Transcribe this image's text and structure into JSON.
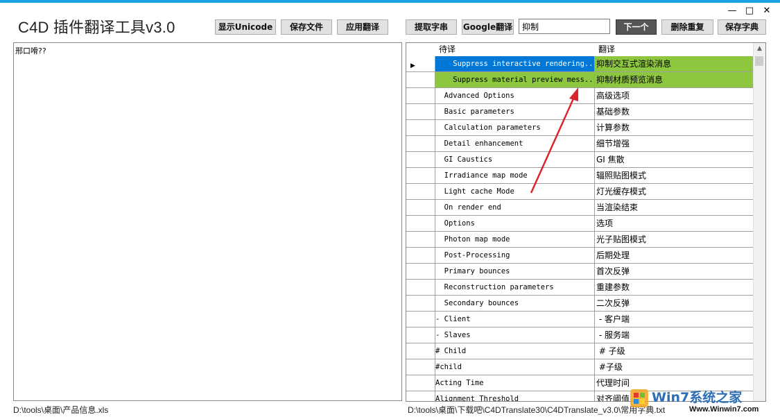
{
  "window": {
    "title": "C4D 插件翻译工具v3.0",
    "minimize": "—",
    "maximize": "□",
    "close": "✕"
  },
  "toolbar": {
    "show_unicode": "显示Unicode",
    "save_file": "保存文件",
    "apply_translation": "应用翻译",
    "extract_strings": "提取字串",
    "google_translate": "Google翻译",
    "search_value": "抑制",
    "next": "下一个",
    "delete_duplicates": "删除重复",
    "save_dictionary": "保存字典"
  },
  "editor": {
    "text": "邢口嗗??"
  },
  "status": {
    "left_path": "D:\\tools\\桌面\\产品信息.xls",
    "right_path": "D:\\tools\\桌面\\下载吧\\C4DTranslate30\\C4DTranslate_v3.0\\常用字典.txt"
  },
  "grid": {
    "headers": [
      "待译",
      "翻译"
    ],
    "current_row_marker": "▶",
    "rows": [
      {
        "source": "    Suppress interactive rendering...",
        "target": "抑制交互式渲染消息"
      },
      {
        "source": "    Suppress material preview mess...",
        "target": "抑制材质预览消息"
      },
      {
        "source": "  Advanced Options",
        "target": "高级选项"
      },
      {
        "source": "  Basic parameters",
        "target": "基础参数"
      },
      {
        "source": "  Calculation parameters",
        "target": "计算参数"
      },
      {
        "source": "  Detail enhancement",
        "target": "细节增强"
      },
      {
        "source": "  GI Caustics",
        "target": "GI 焦散"
      },
      {
        "source": "  Irradiance map mode",
        "target": "辐照贴图模式"
      },
      {
        "source": "  Light cache Mode",
        "target": "灯光缓存模式"
      },
      {
        "source": "  On render end",
        "target": "当渲染结束"
      },
      {
        "source": "  Options",
        "target": "选项"
      },
      {
        "source": "  Photon map mode",
        "target": "光子贴图模式"
      },
      {
        "source": "  Post-Processing",
        "target": "后期处理"
      },
      {
        "source": "  Primary bounces",
        "target": "首次反弹"
      },
      {
        "source": "  Reconstruction parameters",
        "target": "重建参数"
      },
      {
        "source": "  Secondary bounces",
        "target": "二次反弹"
      },
      {
        "source": "- Client",
        "target": " - 客户端"
      },
      {
        "source": "- Slaves",
        "target": " - 服务端"
      },
      {
        "source": "# Child",
        "target": " # 子级"
      },
      {
        "source": "#child",
        "target": " #子级"
      },
      {
        "source": "Acting Time",
        "target": "代理时间"
      },
      {
        "source": "Alignment Threshold",
        "target": "对齐阈值"
      }
    ]
  },
  "watermark": {
    "brand": "Win7系统之家",
    "url": "Www.Winwin7.com"
  },
  "colors": {
    "accent_bar": "#1ba1e2",
    "highlight_green": "#8dc63f",
    "selection_blue": "#0078d7",
    "annotation_arrow": "#d9262b"
  }
}
